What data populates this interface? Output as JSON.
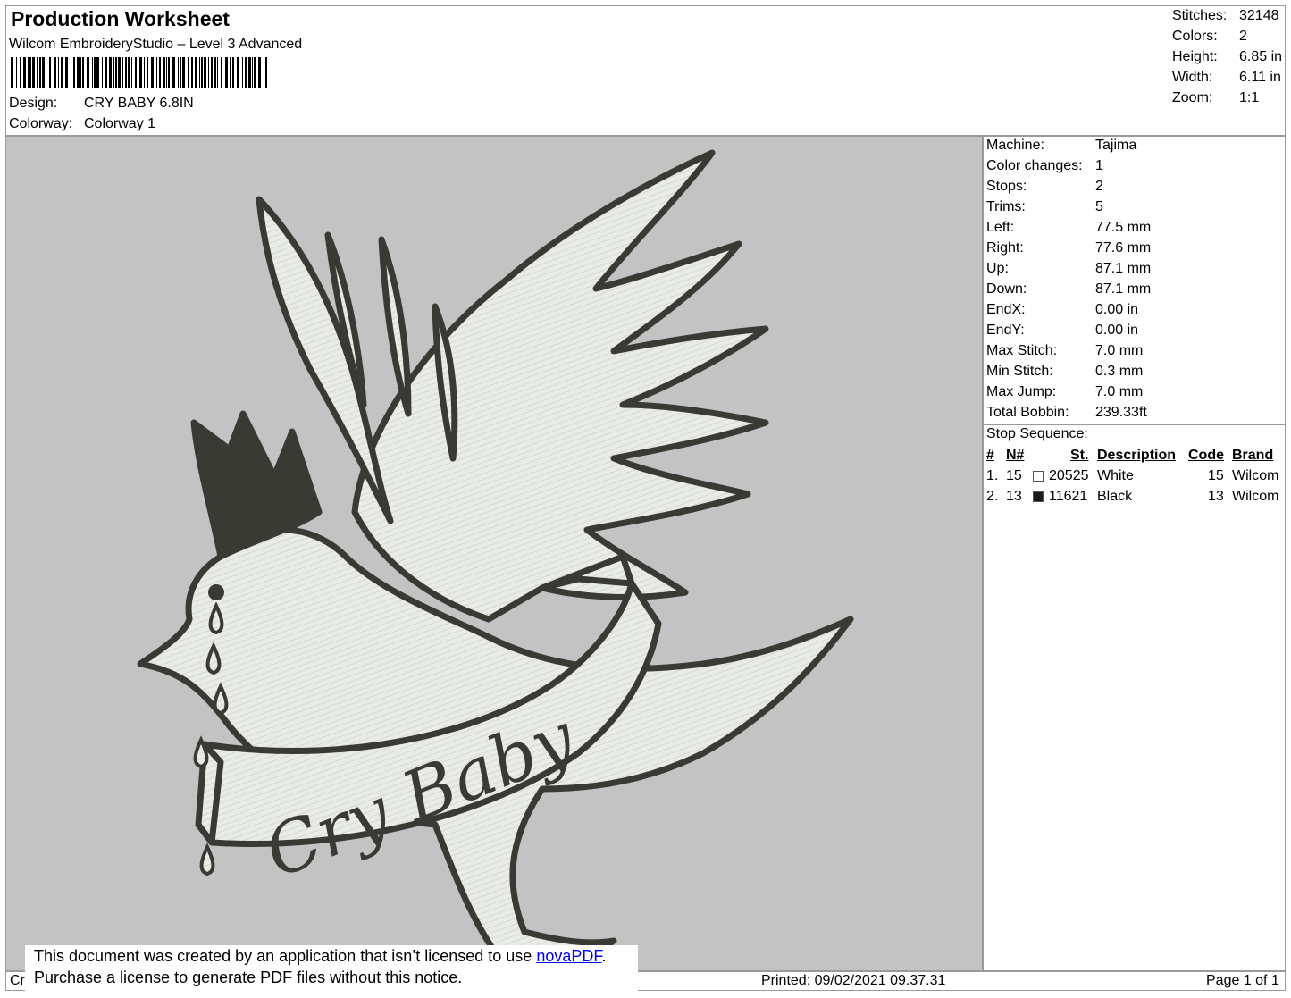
{
  "header": {
    "title": "Production Worksheet",
    "software": "Wilcom EmbroideryStudio – Level 3 Advanced",
    "design_label": "Design:",
    "design_value": "CRY BABY 6.8IN",
    "colorway_label": "Colorway:",
    "colorway_value": "Colorway 1"
  },
  "stats": [
    {
      "label": "Stitches:",
      "value": "32148"
    },
    {
      "label": "Colors:",
      "value": "2"
    },
    {
      "label": "Height:",
      "value": "6.85 in"
    },
    {
      "label": "Width:",
      "value": "6.11 in"
    },
    {
      "label": "Zoom:",
      "value": "1:1"
    }
  ],
  "machine_info": [
    {
      "label": "Machine:",
      "value": "Tajima"
    },
    {
      "label": "Color changes:",
      "value": "1"
    },
    {
      "label": "Stops:",
      "value": "2"
    },
    {
      "label": "Trims:",
      "value": "5"
    },
    {
      "label": "Left:",
      "value": "77.5 mm"
    },
    {
      "label": "Right:",
      "value": "77.6 mm"
    },
    {
      "label": "Up:",
      "value": "87.1 mm"
    },
    {
      "label": "Down:",
      "value": "87.1 mm"
    },
    {
      "label": "EndX:",
      "value": "0.00 in"
    },
    {
      "label": "EndY:",
      "value": "0.00 in"
    },
    {
      "label": "Max Stitch:",
      "value": "7.0 mm"
    },
    {
      "label": "Min Stitch:",
      "value": "0.3 mm"
    },
    {
      "label": "Max Jump:",
      "value": "7.0 mm"
    },
    {
      "label": "Total Bobbin:",
      "value": "239.33ft"
    }
  ],
  "stop_sequence": {
    "label": "Stop Sequence:",
    "columns": {
      "idx": "#",
      "n": "N#",
      "st": "St.",
      "description": "Description",
      "code": "Code",
      "brand": "Brand"
    },
    "rows": [
      {
        "idx": "1.",
        "n": "15",
        "swatch": "#ffffff",
        "st": "20525",
        "description": "White",
        "code": "15",
        "brand": "Wilcom"
      },
      {
        "idx": "2.",
        "n": "13",
        "swatch": "#1a1a1a",
        "st": "11621",
        "description": "Black",
        "code": "13",
        "brand": "Wilcom"
      }
    ]
  },
  "design_preview": {
    "text": "Cry Baby",
    "fill_color": "#e9ebe6",
    "outline_color": "#3a3a35",
    "background": "#c3c3c3"
  },
  "footer": {
    "left_fragment": "Cr",
    "printed": "Printed: 09/02/2021 09.37.31",
    "page": "Page 1 of 1"
  },
  "notice": {
    "line1_prefix": "This document was created by an application that isn’t licensed to use ",
    "link": "novaPDF",
    "line1_suffix": ".",
    "line2": "Purchase a license to generate PDF files without this notice."
  }
}
